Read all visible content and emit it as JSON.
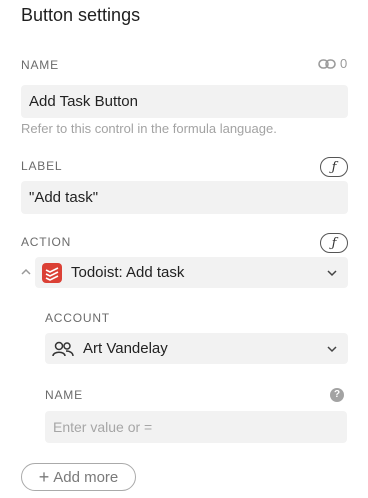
{
  "panel": {
    "title": "Button settings"
  },
  "name_section": {
    "label": "NAME",
    "value": "Add Task Button",
    "helper": "Refer to this control in the formula language.",
    "link_count": "0"
  },
  "label_section": {
    "label": "LABEL",
    "value": "\"Add task\"",
    "formula_icon": "ƒ"
  },
  "action_section": {
    "label": "ACTION",
    "formula_icon": "ƒ",
    "selected_action": "Todoist: Add task",
    "account": {
      "label": "ACCOUNT",
      "value": "Art Vandelay"
    },
    "name": {
      "label": "NAME",
      "placeholder": "Enter value or =",
      "help_icon": "?"
    }
  },
  "add_more": {
    "label": "Add more",
    "icon": "+"
  },
  "colors": {
    "todoist": "#db4035",
    "field_bg": "#f2f2f2"
  }
}
